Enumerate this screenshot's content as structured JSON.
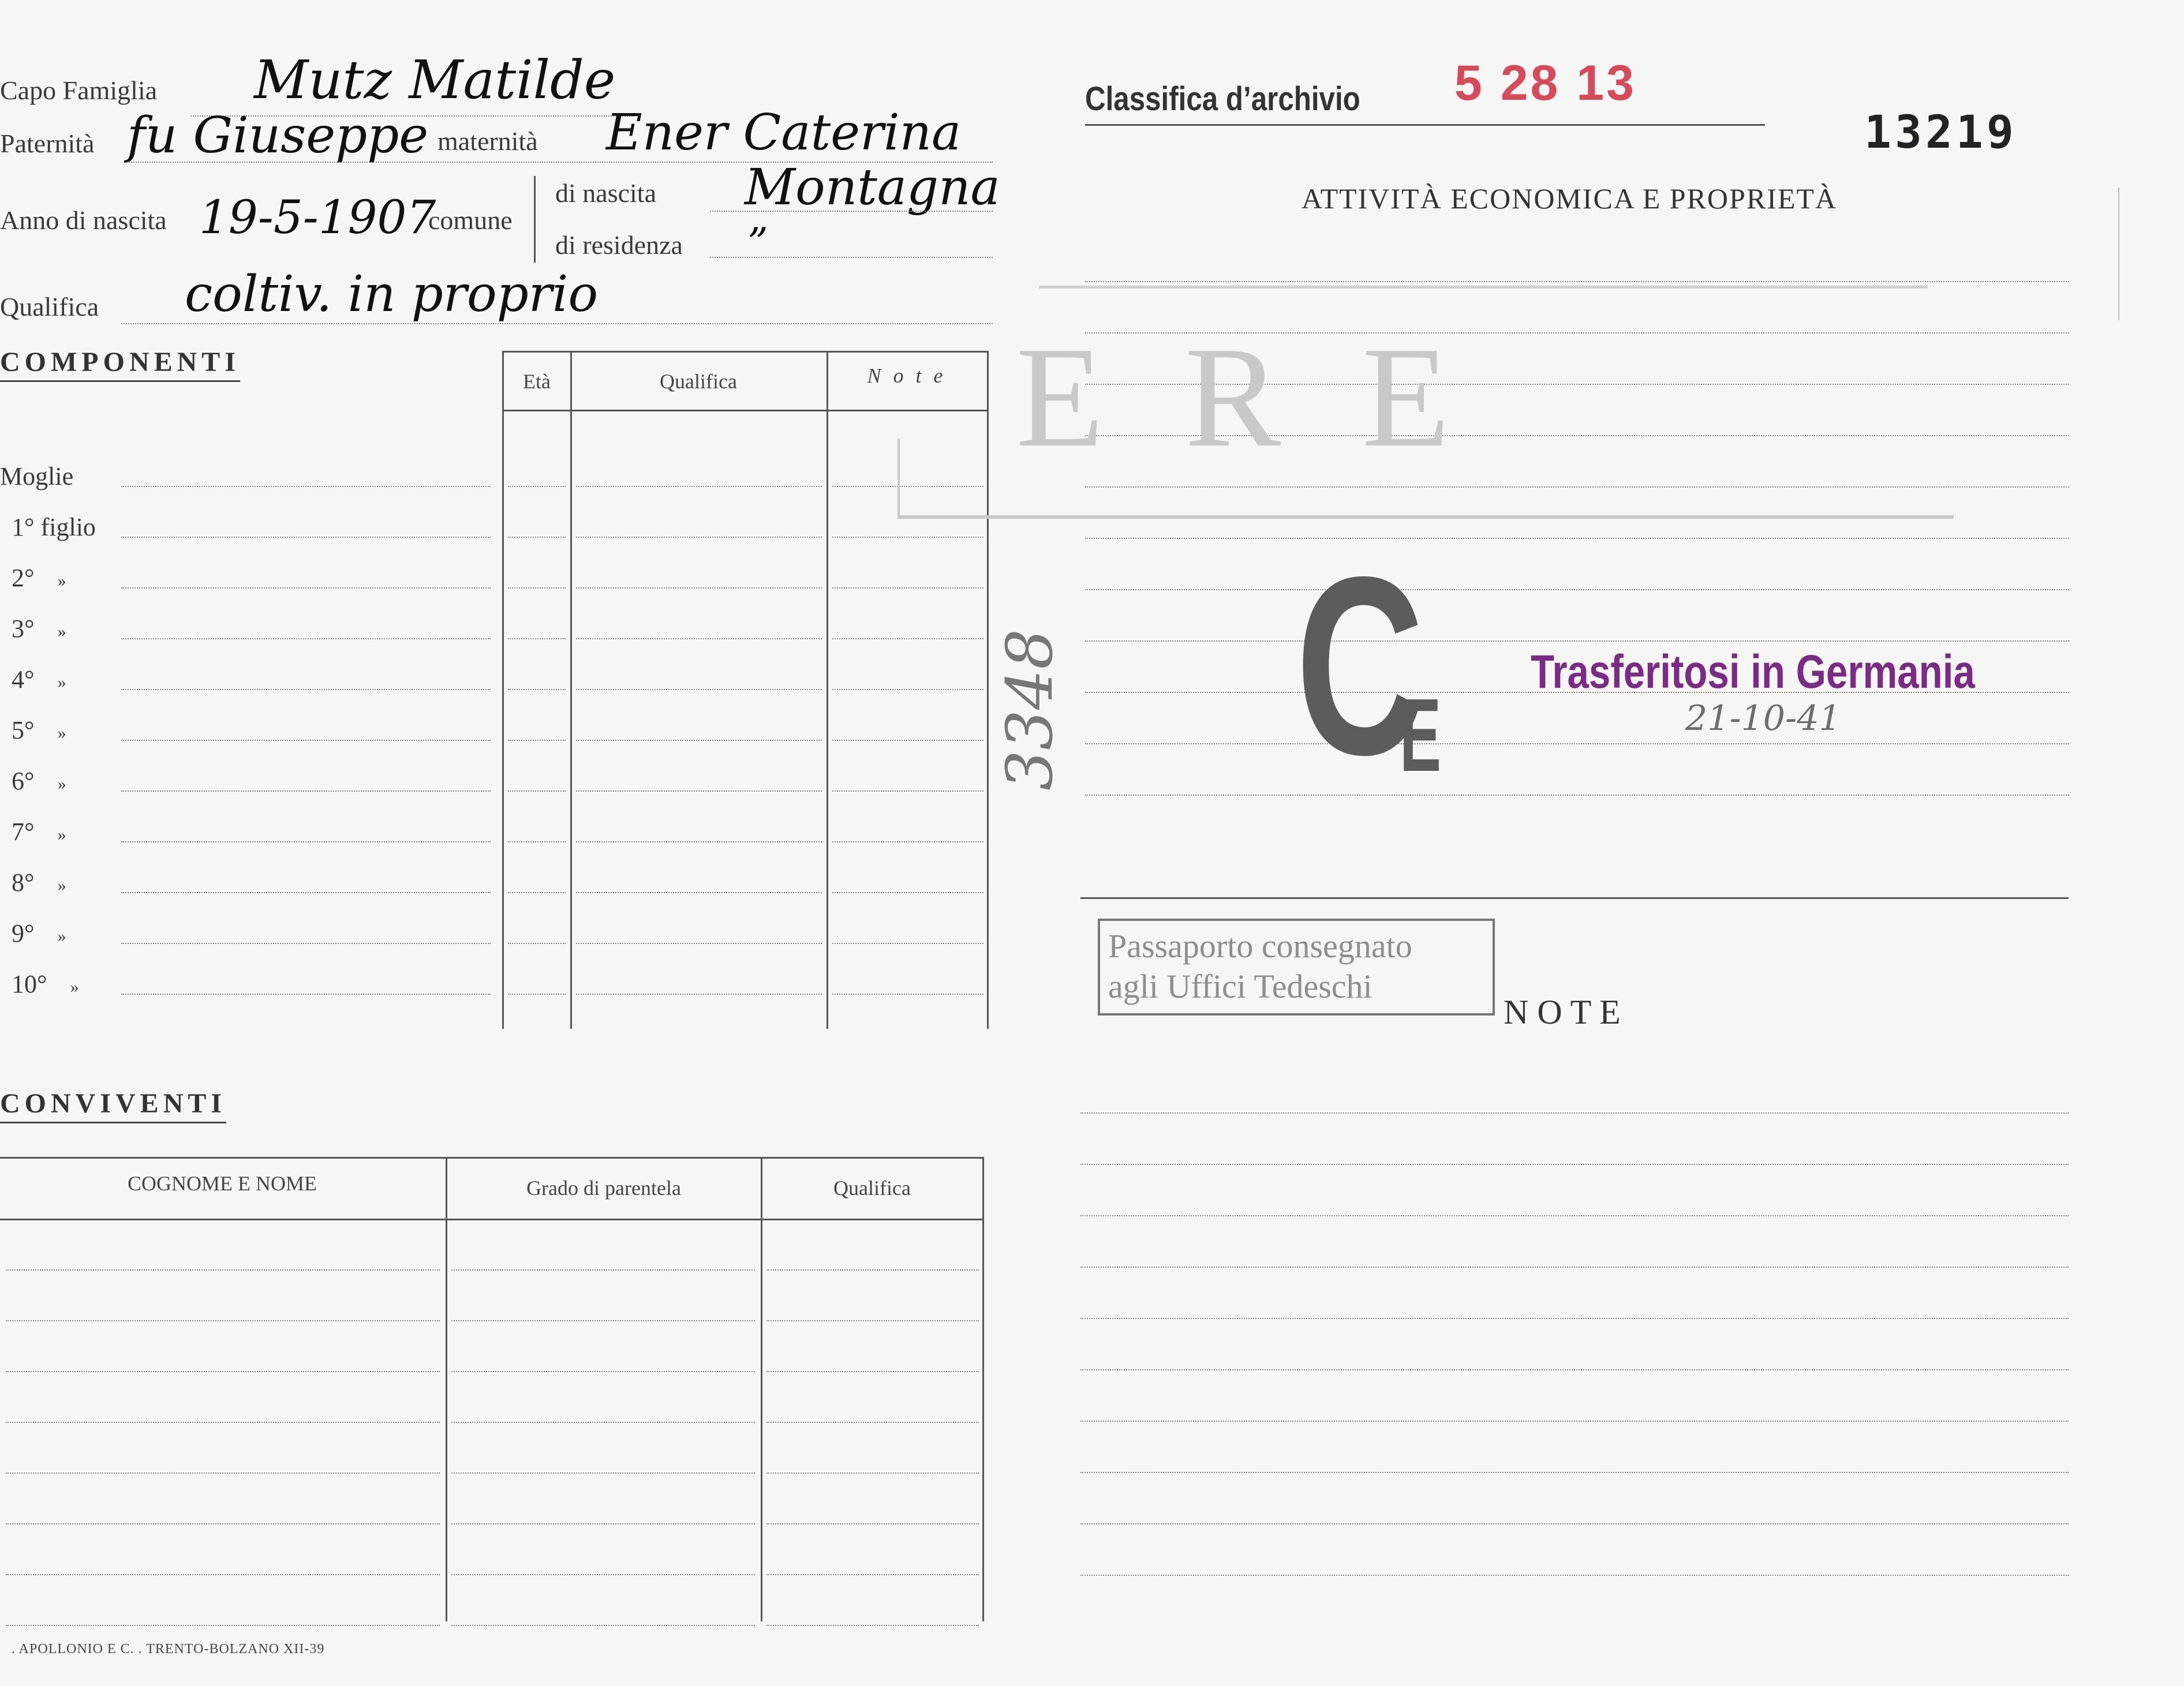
{
  "header": {
    "capo_label": "Capo Famiglia",
    "capo_value": "Mutz Matilde",
    "paternita_label": "Paternità",
    "paternita_value": "fu Giuseppe",
    "maternita_label": "maternità",
    "maternita_value": "Ener Caterina",
    "anno_label": "Anno di nascita",
    "anno_value": "19-5-1907",
    "comune_label": "comune",
    "nascita_label": "di nascita",
    "nascita_value": "Montagna",
    "residenza_label": "di residenza",
    "residenza_value": "”",
    "qualifica_label": "Qualifica",
    "qualifica_value": "coltiv. in proprio"
  },
  "archive": {
    "label": "Classifica d’archivio",
    "stamp_value": "5 28 13",
    "card_number": "13219",
    "section_title": "ATTIVITÀ ECONOMICA E PROPRIETÀ"
  },
  "componenti": {
    "title": "COMPONENTI",
    "columns": [
      "Età",
      "Qualifica",
      "N o t e"
    ],
    "rows": [
      {
        "label": "Moglie",
        "suffix": ""
      },
      {
        "label": "1° figlio",
        "suffix": ""
      },
      {
        "label": "2°",
        "suffix": "»"
      },
      {
        "label": "3°",
        "suffix": "»"
      },
      {
        "label": "4°",
        "suffix": "»"
      },
      {
        "label": "5°",
        "suffix": "»"
      },
      {
        "label": "6°",
        "suffix": "»"
      },
      {
        "label": "7°",
        "suffix": "»"
      },
      {
        "label": "8°",
        "suffix": "»"
      },
      {
        "label": "9°",
        "suffix": "»"
      },
      {
        "label": "10°",
        "suffix": "»"
      }
    ]
  },
  "conviventi": {
    "title": "CONVIVENTI",
    "columns": [
      "COGNOME E NOME",
      "Grado di parentela",
      "Qualifica"
    ]
  },
  "stamps": {
    "ce_big": "C",
    "ce_small": "E",
    "transfer": "Trasferitosi in Germania",
    "transfer_date": "21-10-41",
    "side_number": "3348",
    "passport_line1": "Passaporto consegnato",
    "passport_line2": "agli Uffici Tedeschi",
    "faded_stamp": "ERE"
  },
  "note": {
    "title": "N O T E"
  },
  "footer": {
    "printer": ". APOLLONIO E C. . TRENTO-BOLZANO XII-39"
  },
  "colors": {
    "red_stamp": "#d64a5a",
    "purple_stamp": "#7a2b86",
    "ink": "#111111",
    "paper": "#f6f7f5"
  }
}
